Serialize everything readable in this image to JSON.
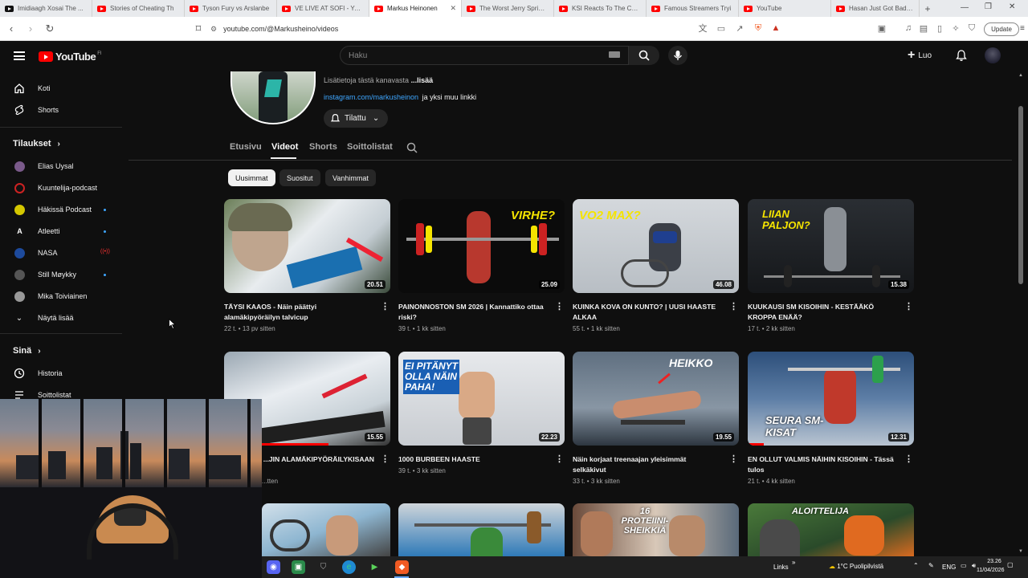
{
  "browser": {
    "tabs": [
      {
        "title": "Imidiaagh Xosai The ..."
      },
      {
        "title": "Stories of Cheating Th"
      },
      {
        "title": "Tyson Fury vs Arslanbe"
      },
      {
        "title": "VE LIVE AT SOFI - Youtu"
      },
      {
        "title": "Markus Heinonen"
      },
      {
        "title": "The Worst Jerry Springe"
      },
      {
        "title": "KSI Reacts To The Craz"
      },
      {
        "title": "Famous Streamers Tryi"
      },
      {
        "title": "YouTube"
      },
      {
        "title": "Hasan Just Got Badly E"
      }
    ],
    "active_tab_index": 4,
    "url": "youtube.com/@Markusheino/videos",
    "update_label": "Update"
  },
  "header": {
    "logo_text": "YouTube",
    "logo_country": "FI",
    "search_placeholder": "Haku",
    "create_label": "Luo"
  },
  "sidebar": {
    "main": [
      {
        "label": "Koti",
        "icon": "home-icon"
      },
      {
        "label": "Shorts",
        "icon": "shorts-icon"
      }
    ],
    "subs_heading": "Tilaukset",
    "subscriptions": [
      {
        "label": "Elias Uysal",
        "color": "#7a5a8a",
        "dot": false
      },
      {
        "label": "Kuuntelija-podcast",
        "color": "#c22",
        "dot": false
      },
      {
        "label": "Häkissä Podcast",
        "color": "#d4c700",
        "dot": true
      },
      {
        "label": "Atleetti",
        "color": "#111",
        "dot": true
      },
      {
        "label": "NASA",
        "color": "#1d4a9c",
        "dot": false
      },
      {
        "label": "Still Møykky",
        "color": "#555",
        "dot": true
      },
      {
        "label": "Mika Toiviainen",
        "color": "#999",
        "dot": false
      }
    ],
    "show_more": "Näytä lisää",
    "you_heading": "Sinä",
    "you_items": [
      {
        "label": "Historia",
        "icon": "history-icon"
      },
      {
        "label": "Soittolistat",
        "icon": "playlist-icon"
      }
    ]
  },
  "channel": {
    "about_text": "Lisätietoja tästä kanavasta",
    "more_label": "...lisää",
    "link_text": "instagram.com/markusheinon",
    "link_suffix": "ja yksi muu linkki",
    "subscribe_label": "Tilattu",
    "tabs": [
      "Etusivu",
      "Videot",
      "Shorts",
      "Soittolistat"
    ],
    "active_tab": "Videot",
    "chips": [
      "Uusimmat",
      "Suositut",
      "Vanhimmat"
    ],
    "active_chip": "Uusimmat"
  },
  "videos": [
    {
      "title": "TÄYSI KAAOS - Näin päättyi alamäkipyöräilyn talvicup",
      "views": "22 t.",
      "age": "13 pv sitten",
      "duration": "20.51",
      "overlay": ""
    },
    {
      "title": "PAINONNOSTON SM 2026 | Kannattiko ottaa riski?",
      "views": "39 t.",
      "age": "1 kk sitten",
      "duration": "25.09",
      "overlay": "VIRHE?"
    },
    {
      "title": "KUINKA KOVA ON KUNTO? | UUSI HAASTE ALKAA",
      "views": "55 t.",
      "age": "1 kk sitten",
      "duration": "46.08",
      "overlay": "VO2 MAX?"
    },
    {
      "title": "KUUKAUSI SM KISOIHIN - KESTÄÄKÖ KROPPA ENÄÄ?",
      "views": "17 t.",
      "age": "2 kk sitten",
      "duration": "15.38",
      "overlay": "LIIAN PALJON?"
    },
    {
      "title": "...JIN ALAMÄKIPYÖRÄILYKISAAN",
      "views": "",
      "age": "...tten",
      "duration": "15.55",
      "overlay": ""
    },
    {
      "title": "1000 BURBEEN HAASTE",
      "views": "39 t.",
      "age": "3 kk sitten",
      "duration": "22.23",
      "overlay": "EI PITÄNYT OLLA NÄIN PAHA!"
    },
    {
      "title": "Näin korjaat treenaajan yleisimmät selkäkivut",
      "views": "33 t.",
      "age": "3 kk sitten",
      "duration": "19.55",
      "overlay": "HEIKKO"
    },
    {
      "title": "EN OLLUT VALMIS NÄIHIN KISOIHIN - Tässä tulos",
      "views": "21 t.",
      "age": "4 kk sitten",
      "duration": "12.31",
      "overlay": "SEURA SM-KISAT"
    },
    {
      "title": "",
      "views": "",
      "age": "",
      "duration": "",
      "overlay": ""
    },
    {
      "title": "",
      "views": "",
      "age": "",
      "duration": "",
      "overlay": ""
    },
    {
      "title": "",
      "views": "",
      "age": "",
      "duration": "",
      "overlay": "16 PROTEIINI-SHEIKKIÄ"
    },
    {
      "title": "",
      "views": "",
      "age": "",
      "duration": "",
      "overlay": "ALOITTELIJA"
    }
  ],
  "taskbar": {
    "links_label": "Links",
    "weather": "1°C Puolipilvistä",
    "lang": "ENG",
    "time": "23.26",
    "date": "11/04/2026"
  },
  "colors": {
    "accent": "#3ea6ff",
    "brand": "#ff0000",
    "overlay_yellow": "#f5e400"
  }
}
